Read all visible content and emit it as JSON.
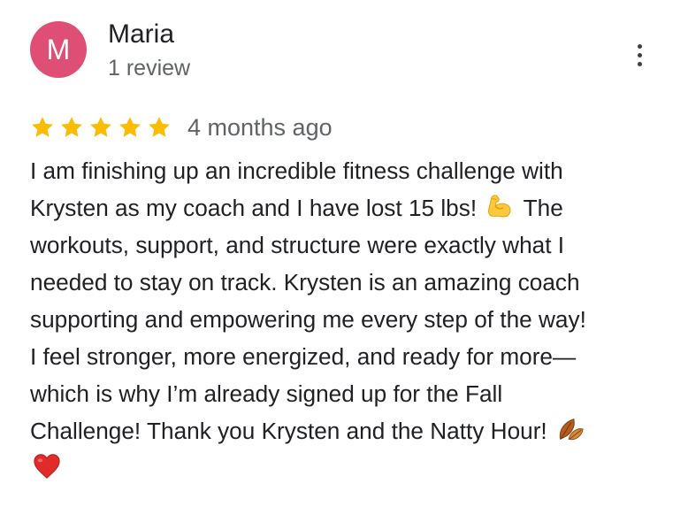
{
  "reviewer": {
    "initial": "M",
    "name": "Maria",
    "review_count": "1 review",
    "avatar_color": "#DF4E74"
  },
  "review": {
    "rating": 5,
    "max_rating": 5,
    "star_color": "#FBBC04",
    "date": "4 months ago",
    "lines": [
      "I am finishing up an incredible fitness challenge with",
      "Krysten as my coach and I have lost 15 lbs!",
      "The",
      "workouts, support, and structure were exactly what I",
      "needed to stay on track. Krysten is an amazing coach",
      "supporting and empowering me every step of the way!",
      "I feel stronger, more energized, and ready for more—",
      "which is why I’m already signed up for the Fall",
      "Challenge! Thank you Krysten and the Natty Hour!"
    ],
    "emojis": [
      "flexed-biceps-icon",
      "fallen-leaf-icon",
      "red-heart-icon"
    ]
  },
  "menu": {
    "icon": "more-vert-icon"
  }
}
